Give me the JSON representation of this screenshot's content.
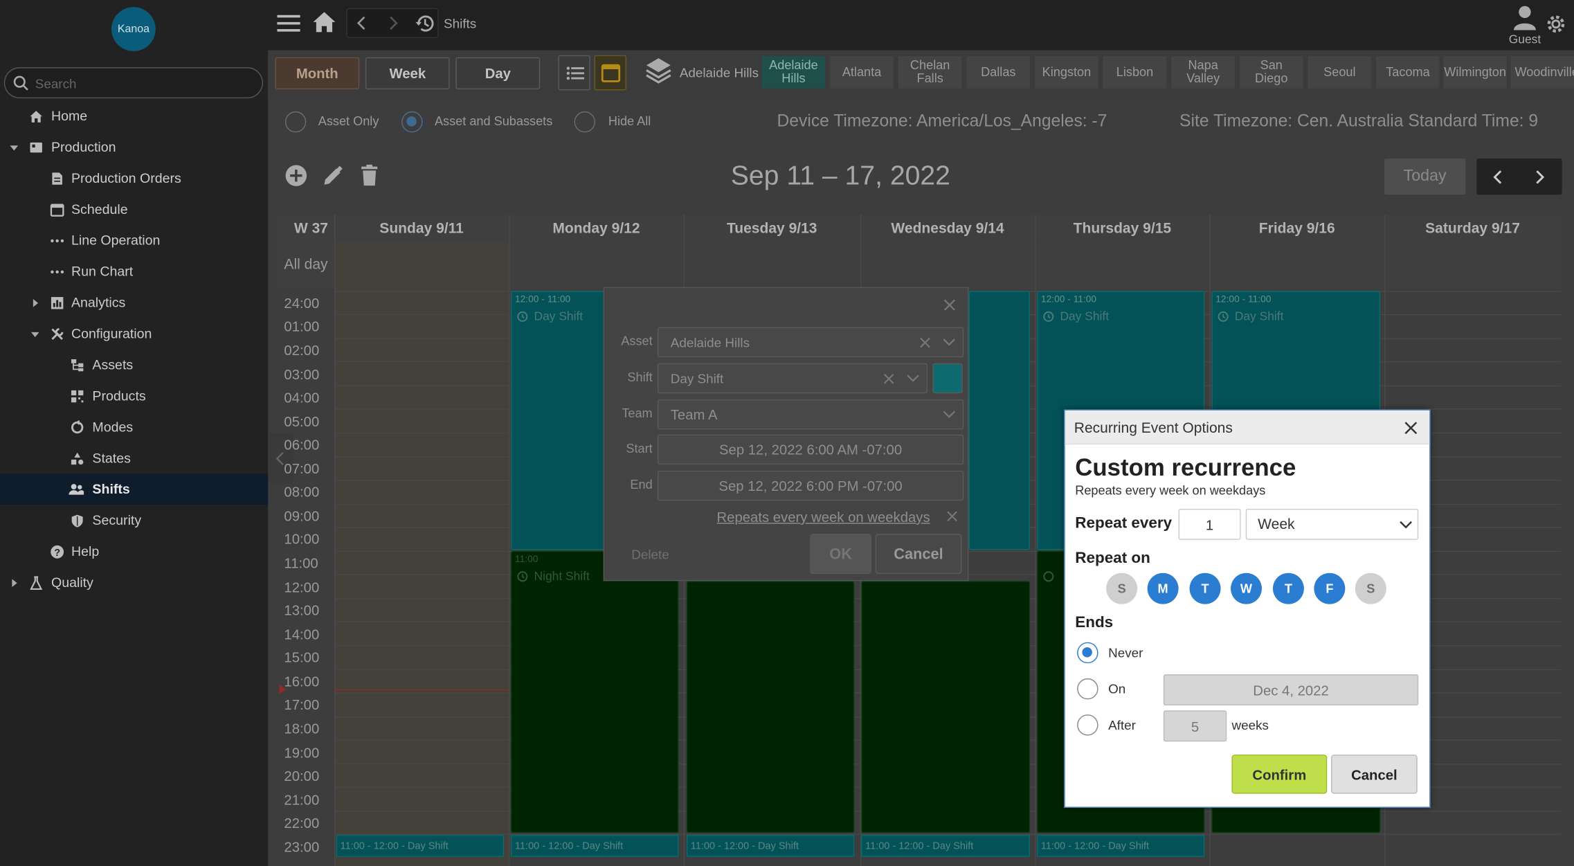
{
  "app": {
    "logo_text": "Kanoa",
    "search_placeholder": "Search"
  },
  "sidebar": {
    "items": [
      {
        "label": "Home"
      },
      {
        "label": "Production"
      },
      {
        "label": "Production Orders"
      },
      {
        "label": "Schedule"
      },
      {
        "label": "Line Operation"
      },
      {
        "label": "Run Chart"
      },
      {
        "label": "Analytics"
      },
      {
        "label": "Configuration"
      },
      {
        "label": "Assets"
      },
      {
        "label": "Products"
      },
      {
        "label": "Modes"
      },
      {
        "label": "States"
      },
      {
        "label": "Shifts"
      },
      {
        "label": "Security"
      },
      {
        "label": "Help"
      },
      {
        "label": "Quality"
      }
    ]
  },
  "topbar": {
    "breadcrumb": "Shifts",
    "user": "Guest"
  },
  "toolbar": {
    "views": [
      "Month",
      "Week",
      "Day"
    ],
    "asset_label": "Adelaide Hills",
    "sites": [
      "Adelaide Hills",
      "Atlanta",
      "Chelan Falls",
      "Dallas",
      "Kingston",
      "Lisbon",
      "Napa Valley",
      "San Diego",
      "Seoul",
      "Tacoma",
      "Wilmington",
      "Woodinville"
    ]
  },
  "options": {
    "radios": [
      "Asset Only",
      "Asset and Subassets",
      "Hide All"
    ],
    "selected": "Asset and Subassets",
    "device_tz": "Device Timezone: America/Los_Angeles: -7",
    "site_tz": "Site Timezone: Cen. Australia Standard Time: 9"
  },
  "calendar": {
    "range_title": "Sep 11 – 17, 2022",
    "today_label": "Today",
    "week_label": "W 37",
    "all_day_label": "All day",
    "columns": [
      "Sunday 9/11",
      "Monday 9/12",
      "Tuesday 9/13",
      "Wednesday 9/14",
      "Thursday 9/15",
      "Friday 9/16",
      "Saturday 9/17"
    ],
    "hours": [
      "24:00",
      "01:00",
      "02:00",
      "03:00",
      "04:00",
      "05:00",
      "06:00",
      "07:00",
      "08:00",
      "09:00",
      "10:00",
      "11:00",
      "12:00",
      "13:00",
      "14:00",
      "15:00",
      "16:00",
      "17:00",
      "18:00",
      "19:00",
      "20:00",
      "21:00",
      "22:00",
      "23:00"
    ],
    "day_event": {
      "time": "12:00 - 11:00",
      "name": "Day Shift"
    },
    "night_event": {
      "time": "11:00",
      "name": "Night Shift"
    },
    "bottom_event": "11:00 - 12:00 - Day Shift"
  },
  "shift_dialog": {
    "asset_label": "Asset",
    "asset_value": "Adelaide Hills",
    "shift_label": "Shift",
    "shift_value": "Day Shift",
    "shift_color": "#0ab3bd",
    "team_label": "Team",
    "team_value": "Team A",
    "start_label": "Start",
    "start_value": "Sep 12, 2022 6:00 AM -07:00",
    "end_label": "End",
    "end_value": "Sep 12, 2022 6:00 PM -07:00",
    "recurrence_link": "Repeats every week on weekdays",
    "delete_label": "Delete",
    "ok_label": "OK",
    "cancel_label": "Cancel"
  },
  "recurrence_dialog": {
    "title": "Recurring Event Options",
    "heading": "Custom recurrence",
    "summary": "Repeats every week on weekdays",
    "repeat_every_label": "Repeat every",
    "repeat_every_value": "1",
    "repeat_unit": "Week",
    "repeat_on_label": "Repeat on",
    "days": [
      {
        "letter": "S",
        "on": false
      },
      {
        "letter": "M",
        "on": true
      },
      {
        "letter": "T",
        "on": true
      },
      {
        "letter": "W",
        "on": true
      },
      {
        "letter": "T",
        "on": true
      },
      {
        "letter": "F",
        "on": true
      },
      {
        "letter": "S",
        "on": false
      }
    ],
    "ends_label": "Ends",
    "never_label": "Never",
    "on_label": "On",
    "on_date": "Dec 4, 2022",
    "after_label": "After",
    "after_value": "5",
    "after_unit": "weeks",
    "ends_selected": "Never",
    "confirm_label": "Confirm",
    "cancel_label": "Cancel",
    "accent": "#2a7dd1",
    "confirm_color": "#bfe04a"
  }
}
